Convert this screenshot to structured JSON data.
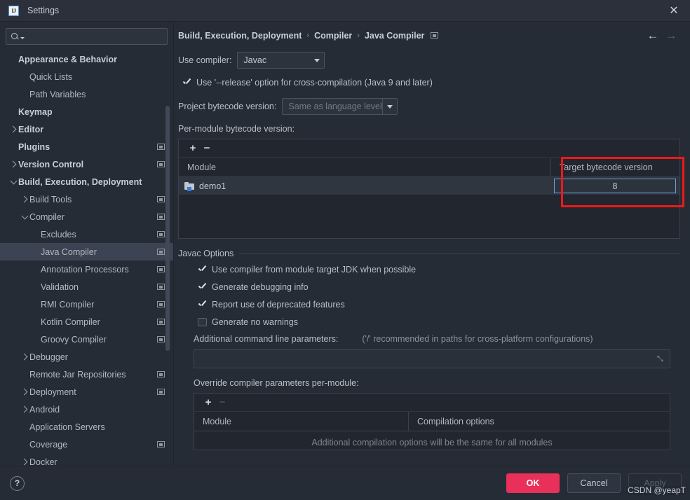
{
  "window": {
    "title": "Settings",
    "logo_text": "IJ",
    "close_label": "✕"
  },
  "search": {
    "value": "",
    "placeholder": ""
  },
  "sidebar": {
    "items": [
      {
        "label": "Appearance & Behavior",
        "indent": 0,
        "bold": true,
        "arrow": "none",
        "badge": false,
        "selected": false
      },
      {
        "label": "Quick Lists",
        "indent": 1,
        "bold": false,
        "arrow": "none",
        "badge": false,
        "selected": false
      },
      {
        "label": "Path Variables",
        "indent": 1,
        "bold": false,
        "arrow": "none",
        "badge": false,
        "selected": false
      },
      {
        "label": "Keymap",
        "indent": 0,
        "bold": true,
        "arrow": "none",
        "badge": false,
        "selected": false
      },
      {
        "label": "Editor",
        "indent": 0,
        "bold": true,
        "arrow": "right",
        "badge": false,
        "selected": false
      },
      {
        "label": "Plugins",
        "indent": 0,
        "bold": true,
        "arrow": "none",
        "badge": true,
        "selected": false
      },
      {
        "label": "Version Control",
        "indent": 0,
        "bold": true,
        "arrow": "right",
        "badge": true,
        "selected": false
      },
      {
        "label": "Build, Execution, Deployment",
        "indent": 0,
        "bold": true,
        "arrow": "down",
        "badge": false,
        "selected": false
      },
      {
        "label": "Build Tools",
        "indent": 1,
        "bold": false,
        "arrow": "right",
        "badge": true,
        "selected": false
      },
      {
        "label": "Compiler",
        "indent": 1,
        "bold": false,
        "arrow": "down",
        "badge": true,
        "selected": false
      },
      {
        "label": "Excludes",
        "indent": 2,
        "bold": false,
        "arrow": "none",
        "badge": true,
        "selected": false
      },
      {
        "label": "Java Compiler",
        "indent": 2,
        "bold": false,
        "arrow": "none",
        "badge": true,
        "selected": true
      },
      {
        "label": "Annotation Processors",
        "indent": 2,
        "bold": false,
        "arrow": "none",
        "badge": true,
        "selected": false
      },
      {
        "label": "Validation",
        "indent": 2,
        "bold": false,
        "arrow": "none",
        "badge": true,
        "selected": false
      },
      {
        "label": "RMI Compiler",
        "indent": 2,
        "bold": false,
        "arrow": "none",
        "badge": true,
        "selected": false
      },
      {
        "label": "Kotlin Compiler",
        "indent": 2,
        "bold": false,
        "arrow": "none",
        "badge": true,
        "selected": false
      },
      {
        "label": "Groovy Compiler",
        "indent": 2,
        "bold": false,
        "arrow": "none",
        "badge": true,
        "selected": false
      },
      {
        "label": "Debugger",
        "indent": 1,
        "bold": false,
        "arrow": "right",
        "badge": false,
        "selected": false
      },
      {
        "label": "Remote Jar Repositories",
        "indent": 1,
        "bold": false,
        "arrow": "none",
        "badge": true,
        "selected": false
      },
      {
        "label": "Deployment",
        "indent": 1,
        "bold": false,
        "arrow": "right",
        "badge": true,
        "selected": false
      },
      {
        "label": "Android",
        "indent": 1,
        "bold": false,
        "arrow": "right",
        "badge": false,
        "selected": false
      },
      {
        "label": "Application Servers",
        "indent": 1,
        "bold": false,
        "arrow": "none",
        "badge": false,
        "selected": false
      },
      {
        "label": "Coverage",
        "indent": 1,
        "bold": false,
        "arrow": "none",
        "badge": true,
        "selected": false
      },
      {
        "label": "Docker",
        "indent": 1,
        "bold": false,
        "arrow": "right",
        "badge": false,
        "selected": false
      }
    ]
  },
  "breadcrumb": {
    "part1": "Build, Execution, Deployment",
    "sep1": "›",
    "part2": "Compiler",
    "sep2": "›",
    "part3": "Java Compiler",
    "back_arrow": "←",
    "forward_arrow": "→"
  },
  "main": {
    "use_compiler_label": "Use compiler:",
    "use_compiler_value": "Javac",
    "release_option_label": "Use '--release' option for cross-compilation (Java 9 and later)",
    "release_option_checked": true,
    "project_bytecode_label": "Project bytecode version:",
    "project_bytecode_value": "Same as language level",
    "per_module_label": "Per-module bytecode version:",
    "add_button": "+",
    "remove_button": "−",
    "module_table": {
      "columns": [
        "Module",
        "Target bytecode version"
      ],
      "rows": [
        {
          "module": "demo1",
          "target_bytecode_version": "8"
        }
      ]
    },
    "javac_options_title": "Javac Options",
    "javac_checkboxes": [
      {
        "label": "Use compiler from module target JDK when possible",
        "checked": true
      },
      {
        "label": "Generate debugging info",
        "checked": true
      },
      {
        "label": "Report use of deprecated features",
        "checked": true
      },
      {
        "label": "Generate no warnings",
        "checked": false
      }
    ],
    "additional_params_label": "Additional command line parameters:",
    "additional_params_hint": "('/' recommended in paths for cross-platform configurations)",
    "additional_params_value": "",
    "expand_icon": "⤡",
    "override_label": "Override compiler parameters per-module:",
    "override_add_button": "+",
    "override_remove_button": "−",
    "override_table": {
      "columns": [
        "Module",
        "Compilation options"
      ],
      "empty_message": "Additional compilation options will be the same for all modules"
    }
  },
  "footer": {
    "help_label": "?",
    "ok_label": "OK",
    "cancel_label": "Cancel",
    "apply_label": "Apply",
    "watermark": "CSDN @yeapT"
  },
  "colors": {
    "accent_primary": "#e8305a",
    "annotation_red": "#f01818",
    "focus_blue": "#6aa2e0",
    "selection_bg": "#3c4453",
    "window_bg": "#262c36"
  }
}
